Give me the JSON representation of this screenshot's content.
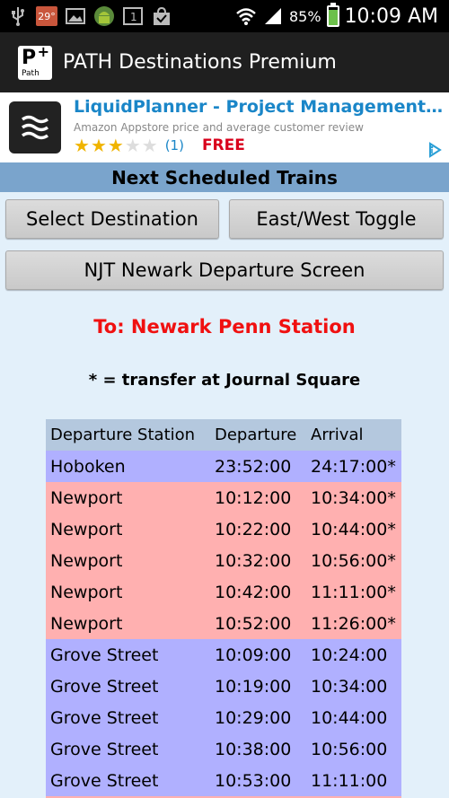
{
  "status_bar": {
    "temperature": "29°",
    "battery_percent": "85%",
    "battery_level": 0.85,
    "time": "10:09 AM",
    "icons": [
      "usb-icon",
      "temperature-icon",
      "image-icon",
      "android-icon",
      "notification-1-icon",
      "shopping-bag-icon",
      "wifi-icon",
      "signal-icon",
      "battery-icon"
    ]
  },
  "app": {
    "logo_text": "P",
    "logo_sub": "Path",
    "logo_plus": "+",
    "title": "PATH Destinations Premium"
  },
  "ad": {
    "title": "LiquidPlanner - Project Management…",
    "subtitle": "Amazon Appstore price and average customer review",
    "rating": 3,
    "rating_max": 5,
    "count": "(1)",
    "price": "FREE"
  },
  "header": {
    "title": "Next Scheduled Trains"
  },
  "buttons": {
    "select_destination": "Select Destination",
    "east_west_toggle": "East/West Toggle",
    "njt_newark": "NJT Newark Departure Screen"
  },
  "destination_heading": "To: Newark Penn Station",
  "transfer_note": "* = transfer at Journal Square",
  "table": {
    "columns": [
      "Departure Station",
      "Departure",
      "Arrival"
    ],
    "rows": [
      {
        "station": "Hoboken",
        "departure": "23:52:00",
        "arrival": "24:17:00*",
        "color": "purple"
      },
      {
        "station": "Newport",
        "departure": "10:12:00",
        "arrival": "10:34:00*",
        "color": "pink"
      },
      {
        "station": "Newport",
        "departure": "10:22:00",
        "arrival": "10:44:00*",
        "color": "pink"
      },
      {
        "station": "Newport",
        "departure": "10:32:00",
        "arrival": "10:56:00*",
        "color": "pink"
      },
      {
        "station": "Newport",
        "departure": "10:42:00",
        "arrival": "11:11:00*",
        "color": "pink"
      },
      {
        "station": "Newport",
        "departure": "10:52:00",
        "arrival": "11:26:00*",
        "color": "pink"
      },
      {
        "station": "Grove Street",
        "departure": "10:09:00",
        "arrival": "10:24:00",
        "color": "purple"
      },
      {
        "station": "Grove Street",
        "departure": "10:19:00",
        "arrival": "10:34:00",
        "color": "purple"
      },
      {
        "station": "Grove Street",
        "departure": "10:29:00",
        "arrival": "10:44:00",
        "color": "purple"
      },
      {
        "station": "Grove Street",
        "departure": "10:38:00",
        "arrival": "10:56:00",
        "color": "purple"
      },
      {
        "station": "Grove Street",
        "departure": "10:53:00",
        "arrival": "11:11:00",
        "color": "purple"
      }
    ]
  },
  "colors": {
    "purple_row": "#b0b0ff",
    "pink_row": "#ffb0b0",
    "header_row": "#b4c8de",
    "heading_red": "#f01010",
    "band_blue": "#7aa4cc"
  }
}
